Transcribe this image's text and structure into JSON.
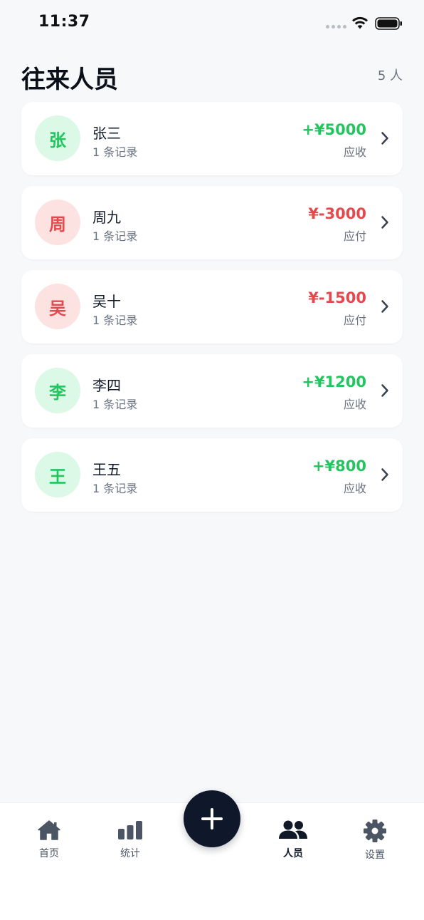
{
  "status_bar": {
    "time": "11:37"
  },
  "header": {
    "title": "往来人员",
    "count": "5 人"
  },
  "people": [
    {
      "initial": "张",
      "name": "张三",
      "records": "1 条记录",
      "amount": "+¥5000",
      "type": "应收",
      "sign": "pos"
    },
    {
      "initial": "周",
      "name": "周九",
      "records": "1 条记录",
      "amount": "¥-3000",
      "type": "应付",
      "sign": "neg"
    },
    {
      "initial": "吴",
      "name": "吴十",
      "records": "1 条记录",
      "amount": "¥-1500",
      "type": "应付",
      "sign": "neg"
    },
    {
      "initial": "李",
      "name": "李四",
      "records": "1 条记录",
      "amount": "+¥1200",
      "type": "应收",
      "sign": "pos"
    },
    {
      "initial": "王",
      "name": "王五",
      "records": "1 条记录",
      "amount": "+¥800",
      "type": "应收",
      "sign": "pos"
    }
  ],
  "nav": {
    "home": "首页",
    "stats": "统计",
    "people": "人员",
    "settings": "设置",
    "active": "people"
  },
  "colors": {
    "positive": "#22c55e",
    "negative": "#e5484d",
    "positive_bg": "#dcf8e6",
    "negative_bg": "#fde2e2",
    "fab": "#0f172a"
  },
  "icons": {
    "home": "house-icon",
    "stats": "bar-chart-icon",
    "add": "plus-icon",
    "people": "people-icon",
    "settings": "gear-icon",
    "row_action": "chevron-right-icon"
  }
}
